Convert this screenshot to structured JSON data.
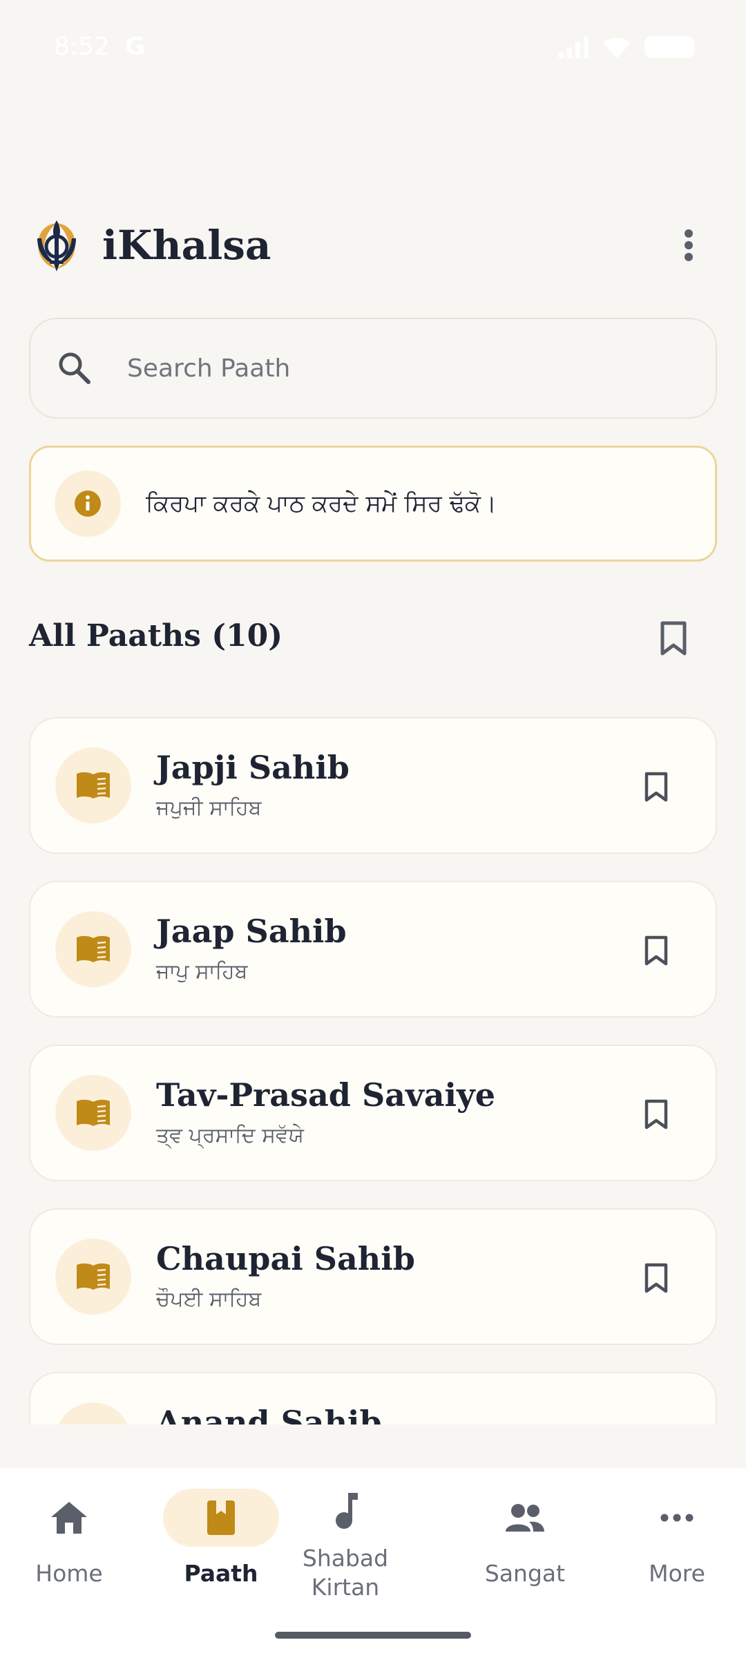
{
  "status_bar": {
    "time": "8:52",
    "carrier_glyph": "G"
  },
  "header": {
    "app_title": "iKhalsa"
  },
  "search": {
    "placeholder": "Search Paath"
  },
  "notice": {
    "text": "ਕਿਰਪਾ ਕਰਕੇ ਪਾਠ ਕਰਦੇ ਸਮੇਂ ਸਿਰ ਢੱਕੋ।"
  },
  "section": {
    "title": "All Paaths (10)"
  },
  "paaths": [
    {
      "title": "Japji Sahib",
      "subtitle": "ਜਪੁਜੀ ਸਾਹਿਬ"
    },
    {
      "title": "Jaap Sahib",
      "subtitle": "ਜਾਪੁ ਸਾਹਿਬ"
    },
    {
      "title": "Tav-Prasad Savaiye",
      "subtitle": "ਤ੍ਵ ਪ੍ਰਸਾਦਿ ਸਵੱਯੇ"
    },
    {
      "title": "Chaupai Sahib",
      "subtitle": "ਚੌਪਈ ਸਾਹਿਬ"
    },
    {
      "title": "Anand Sahib",
      "subtitle": ""
    }
  ],
  "bottom_nav": {
    "home": "Home",
    "paath": "Paath",
    "shabad_line1": "Shabad",
    "shabad_line2": "Kirtan",
    "sangat": "Sangat",
    "more": "More"
  },
  "colors": {
    "background": "#f8f6f2",
    "accent_gold": "#c08a18",
    "accent_light": "#fcefd9",
    "text_dark": "#1f2433",
    "notice_border": "#ecd59a"
  }
}
